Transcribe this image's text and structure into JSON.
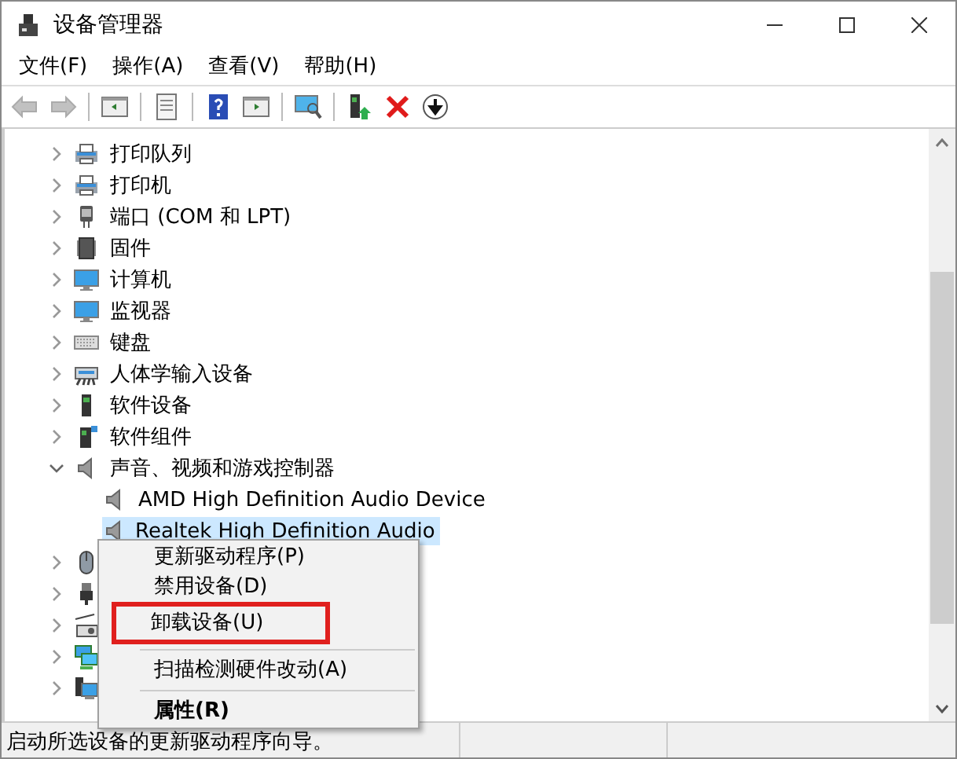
{
  "window": {
    "title": "设备管理器"
  },
  "menu_bar": [
    {
      "label": "文件(F)"
    },
    {
      "label": "操作(A)"
    },
    {
      "label": "查看(V)"
    },
    {
      "label": "帮助(H)"
    }
  ],
  "toolbar": [
    {
      "kind": "back",
      "disabled": true
    },
    {
      "kind": "forward",
      "disabled": true
    },
    {
      "kind": "separator"
    },
    {
      "kind": "console-tree",
      "disabled": false
    },
    {
      "kind": "separator"
    },
    {
      "kind": "properties",
      "disabled": false
    },
    {
      "kind": "separator"
    },
    {
      "kind": "help",
      "disabled": false
    },
    {
      "kind": "action-pane",
      "disabled": false
    },
    {
      "kind": "separator"
    },
    {
      "kind": "scan",
      "disabled": false
    },
    {
      "kind": "separator"
    },
    {
      "kind": "update-driver",
      "disabled": false
    },
    {
      "kind": "uninstall",
      "disabled": false
    },
    {
      "kind": "disable",
      "disabled": false
    }
  ],
  "tree": [
    {
      "kind": "printer",
      "label": "打印队列",
      "expanded": false
    },
    {
      "kind": "printer",
      "label": "打印机",
      "expanded": false
    },
    {
      "kind": "port",
      "label": "端口 (COM 和 LPT)",
      "expanded": false
    },
    {
      "kind": "chip",
      "label": "固件",
      "expanded": false
    },
    {
      "kind": "monitor",
      "label": "计算机",
      "expanded": false
    },
    {
      "kind": "monitor",
      "label": "监视器",
      "expanded": false
    },
    {
      "kind": "keyboard",
      "label": "键盘",
      "expanded": false
    },
    {
      "kind": "hid",
      "label": "人体学输入设备",
      "expanded": false
    },
    {
      "kind": "software-device",
      "label": "软件设备",
      "expanded": false
    },
    {
      "kind": "software-component",
      "label": "软件组件",
      "expanded": false
    },
    {
      "kind": "speaker",
      "label": "声音、视频和游戏控制器",
      "expanded": true,
      "children": [
        {
          "kind": "speaker",
          "label": "AMD High Definition Audio Device",
          "selected": false
        },
        {
          "kind": "speaker",
          "label": "Realtek High Definition Audio",
          "selected": true
        }
      ]
    },
    {
      "kind": "mouse",
      "expanded": false
    },
    {
      "kind": "usb",
      "expanded": false
    },
    {
      "kind": "storage",
      "expanded": false
    },
    {
      "kind": "network",
      "expanded": false
    },
    {
      "kind": "computer",
      "expanded": false
    }
  ],
  "context_menu": [
    {
      "kind": "item",
      "label": "更新驱动程序(P)",
      "highlighted": false,
      "bold": false
    },
    {
      "kind": "item",
      "label": "禁用设备(D)",
      "highlighted": false,
      "bold": false
    },
    {
      "kind": "item",
      "label": "卸载设备(U)",
      "highlighted": true,
      "bold": false
    },
    {
      "kind": "separator"
    },
    {
      "kind": "item",
      "label": "扫描检测硬件改动(A)",
      "highlighted": false,
      "bold": false
    },
    {
      "kind": "separator"
    },
    {
      "kind": "item",
      "label": "属性(R)",
      "highlighted": false,
      "bold": true
    }
  ],
  "status_bar": {
    "text": "启动所选设备的更新驱动程序向导。"
  }
}
